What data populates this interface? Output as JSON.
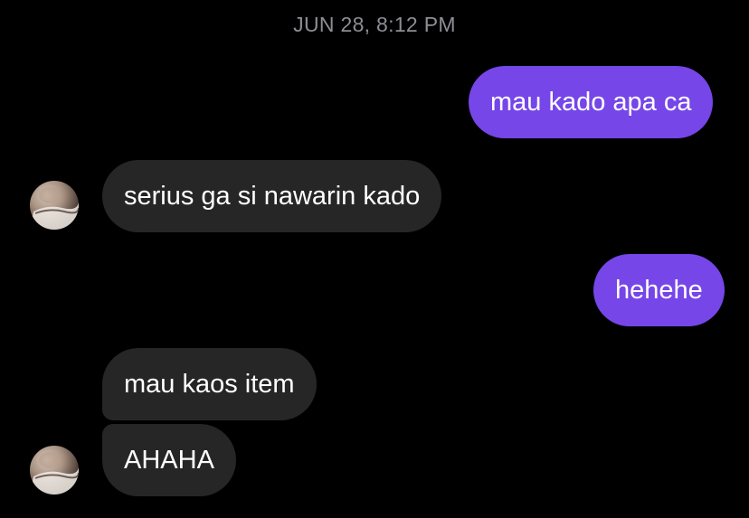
{
  "conversation": {
    "timestamp": "JUN 28, 8:12 PM",
    "messages": [
      {
        "sender": "me",
        "text": "mau kado apa ca"
      },
      {
        "sender": "other",
        "text": "serius ga si nawarin kado"
      },
      {
        "sender": "me",
        "text": "hehehe"
      },
      {
        "sender": "other",
        "text": "mau kaos item"
      },
      {
        "sender": "other",
        "text": "AHAHA"
      }
    ]
  },
  "colors": {
    "background": "#000000",
    "sent_bubble": "#7646e8",
    "received_bubble": "#262626",
    "timestamp_text": "#8e8e93",
    "message_text": "#ffffff"
  },
  "icons": {
    "contact_avatar": "profile-photo"
  }
}
